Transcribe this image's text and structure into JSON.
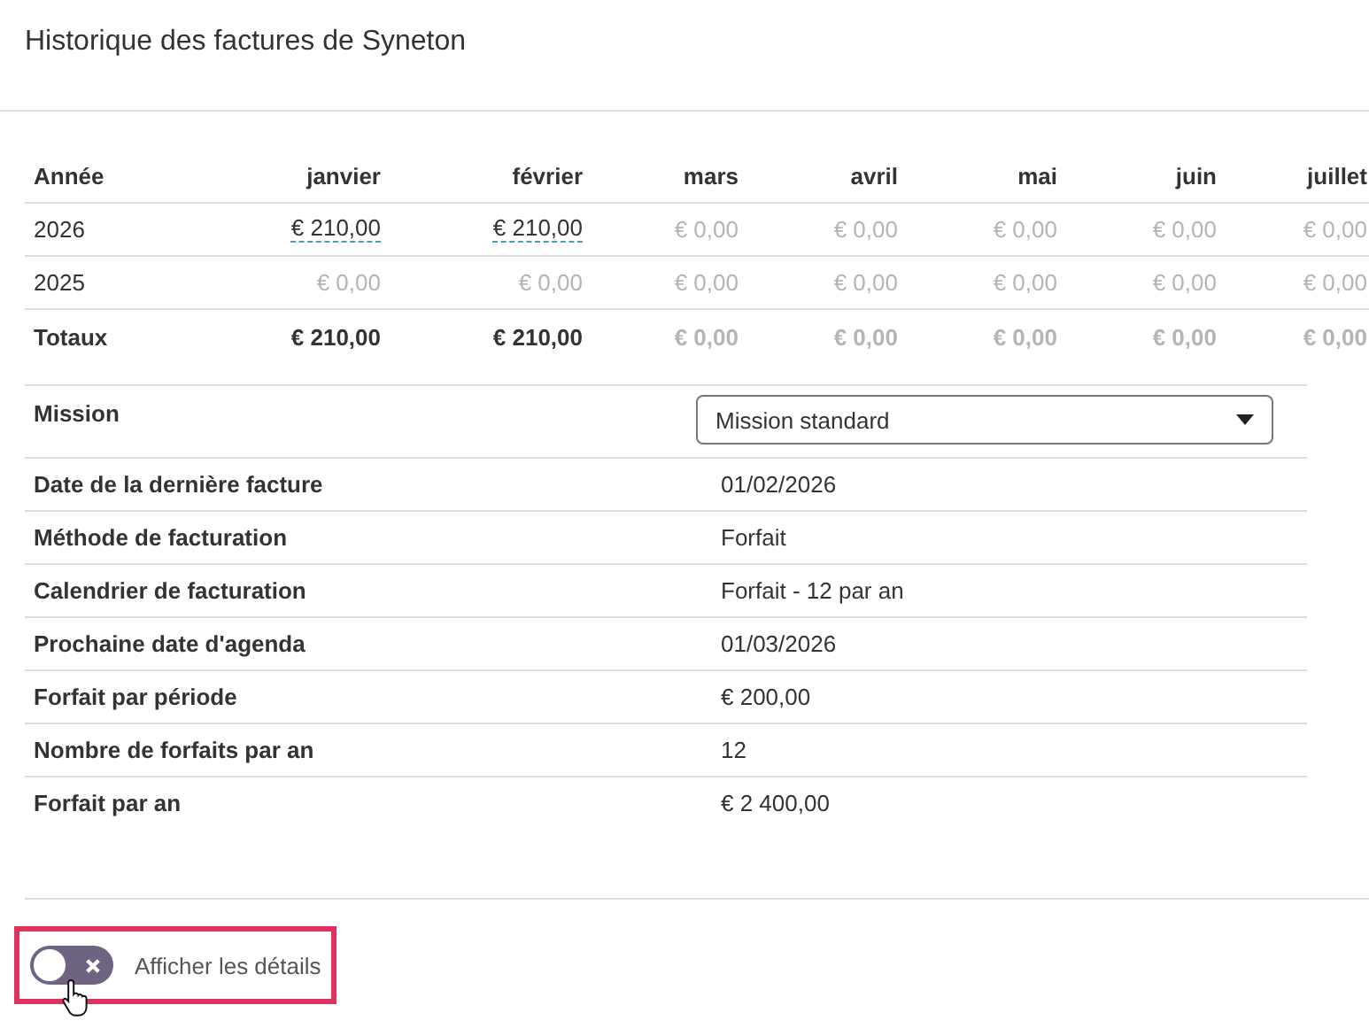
{
  "title": "Historique des factures de Syneton",
  "history": {
    "columns": [
      "Année",
      "janvier",
      "février",
      "mars",
      "avril",
      "mai",
      "juin",
      "juillet"
    ],
    "rows": [
      {
        "kind": "year",
        "cells": [
          {
            "text": "2026",
            "muted": false,
            "link": false
          },
          {
            "text": "€ 210,00",
            "muted": false,
            "link": true
          },
          {
            "text": "€ 210,00",
            "muted": false,
            "link": true
          },
          {
            "text": "€ 0,00",
            "muted": true,
            "link": false
          },
          {
            "text": "€ 0,00",
            "muted": true,
            "link": false
          },
          {
            "text": "€ 0,00",
            "muted": true,
            "link": false
          },
          {
            "text": "€ 0,00",
            "muted": true,
            "link": false
          },
          {
            "text": "€ 0,00",
            "muted": true,
            "link": false
          }
        ]
      },
      {
        "kind": "year",
        "cells": [
          {
            "text": "2025",
            "muted": false,
            "link": false
          },
          {
            "text": "€ 0,00",
            "muted": true,
            "link": false
          },
          {
            "text": "€ 0,00",
            "muted": true,
            "link": false
          },
          {
            "text": "€ 0,00",
            "muted": true,
            "link": false
          },
          {
            "text": "€ 0,00",
            "muted": true,
            "link": false
          },
          {
            "text": "€ 0,00",
            "muted": true,
            "link": false
          },
          {
            "text": "€ 0,00",
            "muted": true,
            "link": false
          },
          {
            "text": "€ 0,00",
            "muted": true,
            "link": false
          }
        ]
      },
      {
        "kind": "total",
        "cells": [
          {
            "text": "Totaux",
            "muted": false,
            "link": false
          },
          {
            "text": "€ 210,00",
            "muted": false,
            "link": false
          },
          {
            "text": "€ 210,00",
            "muted": false,
            "link": false
          },
          {
            "text": "€ 0,00",
            "muted": true,
            "link": false
          },
          {
            "text": "€ 0,00",
            "muted": true,
            "link": false
          },
          {
            "text": "€ 0,00",
            "muted": true,
            "link": false
          },
          {
            "text": "€ 0,00",
            "muted": true,
            "link": false
          },
          {
            "text": "€ 0,00",
            "muted": true,
            "link": false
          }
        ]
      }
    ]
  },
  "details": [
    {
      "kind": "select",
      "label": "Mission",
      "value": "Mission standard"
    },
    {
      "kind": "text",
      "label": "Date de la dernière facture",
      "value": "01/02/2026"
    },
    {
      "kind": "text",
      "label": "Méthode de facturation",
      "value": "Forfait"
    },
    {
      "kind": "text",
      "label": "Calendrier de facturation",
      "value": "Forfait - 12 par an"
    },
    {
      "kind": "text",
      "label": "Prochaine date d'agenda",
      "value": "01/03/2026"
    },
    {
      "kind": "text",
      "label": "Forfait par période",
      "value": "€ 200,00"
    },
    {
      "kind": "text",
      "label": "Nombre de forfaits par an",
      "value": "12"
    },
    {
      "kind": "text",
      "label": "Forfait par an",
      "value": "€ 2 400,00"
    }
  ],
  "toggle": {
    "label": "Afficher les détails",
    "on": false,
    "highlighted": true
  }
}
